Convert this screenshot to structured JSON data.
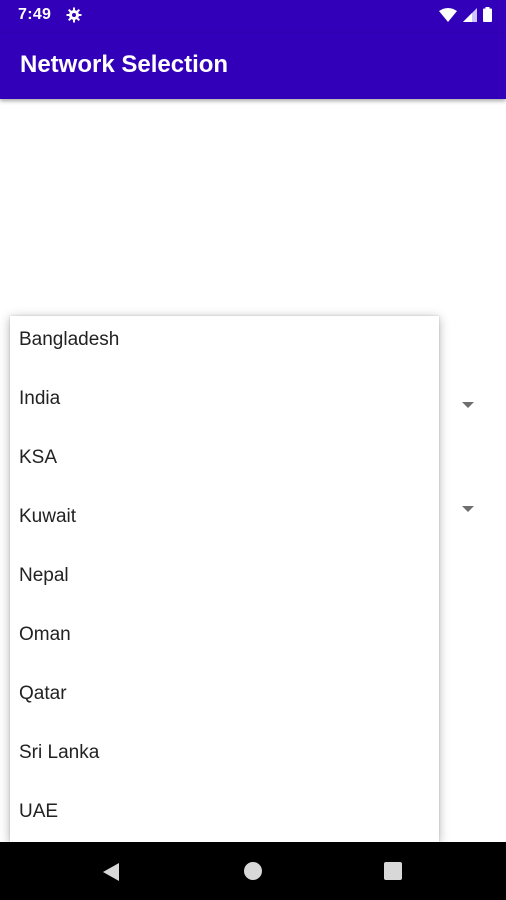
{
  "status_bar": {
    "time": "7:49",
    "icons": [
      "settings-gear-icon",
      "wifi-icon",
      "cell-signal-icon",
      "battery-icon"
    ]
  },
  "app_bar": {
    "title": "Network Selection",
    "color": "#3200b8"
  },
  "spinners": {
    "icons": [
      "dropdown-arrow-icon",
      "dropdown-arrow-icon"
    ]
  },
  "dropdown": {
    "items": [
      "Bangladesh",
      "India",
      "KSA",
      "Kuwait",
      "Nepal",
      "Oman",
      "Qatar",
      "Sri Lanka",
      "UAE"
    ]
  },
  "nav_bar": {
    "icons": [
      "back-icon",
      "home-icon",
      "recents-icon"
    ]
  }
}
